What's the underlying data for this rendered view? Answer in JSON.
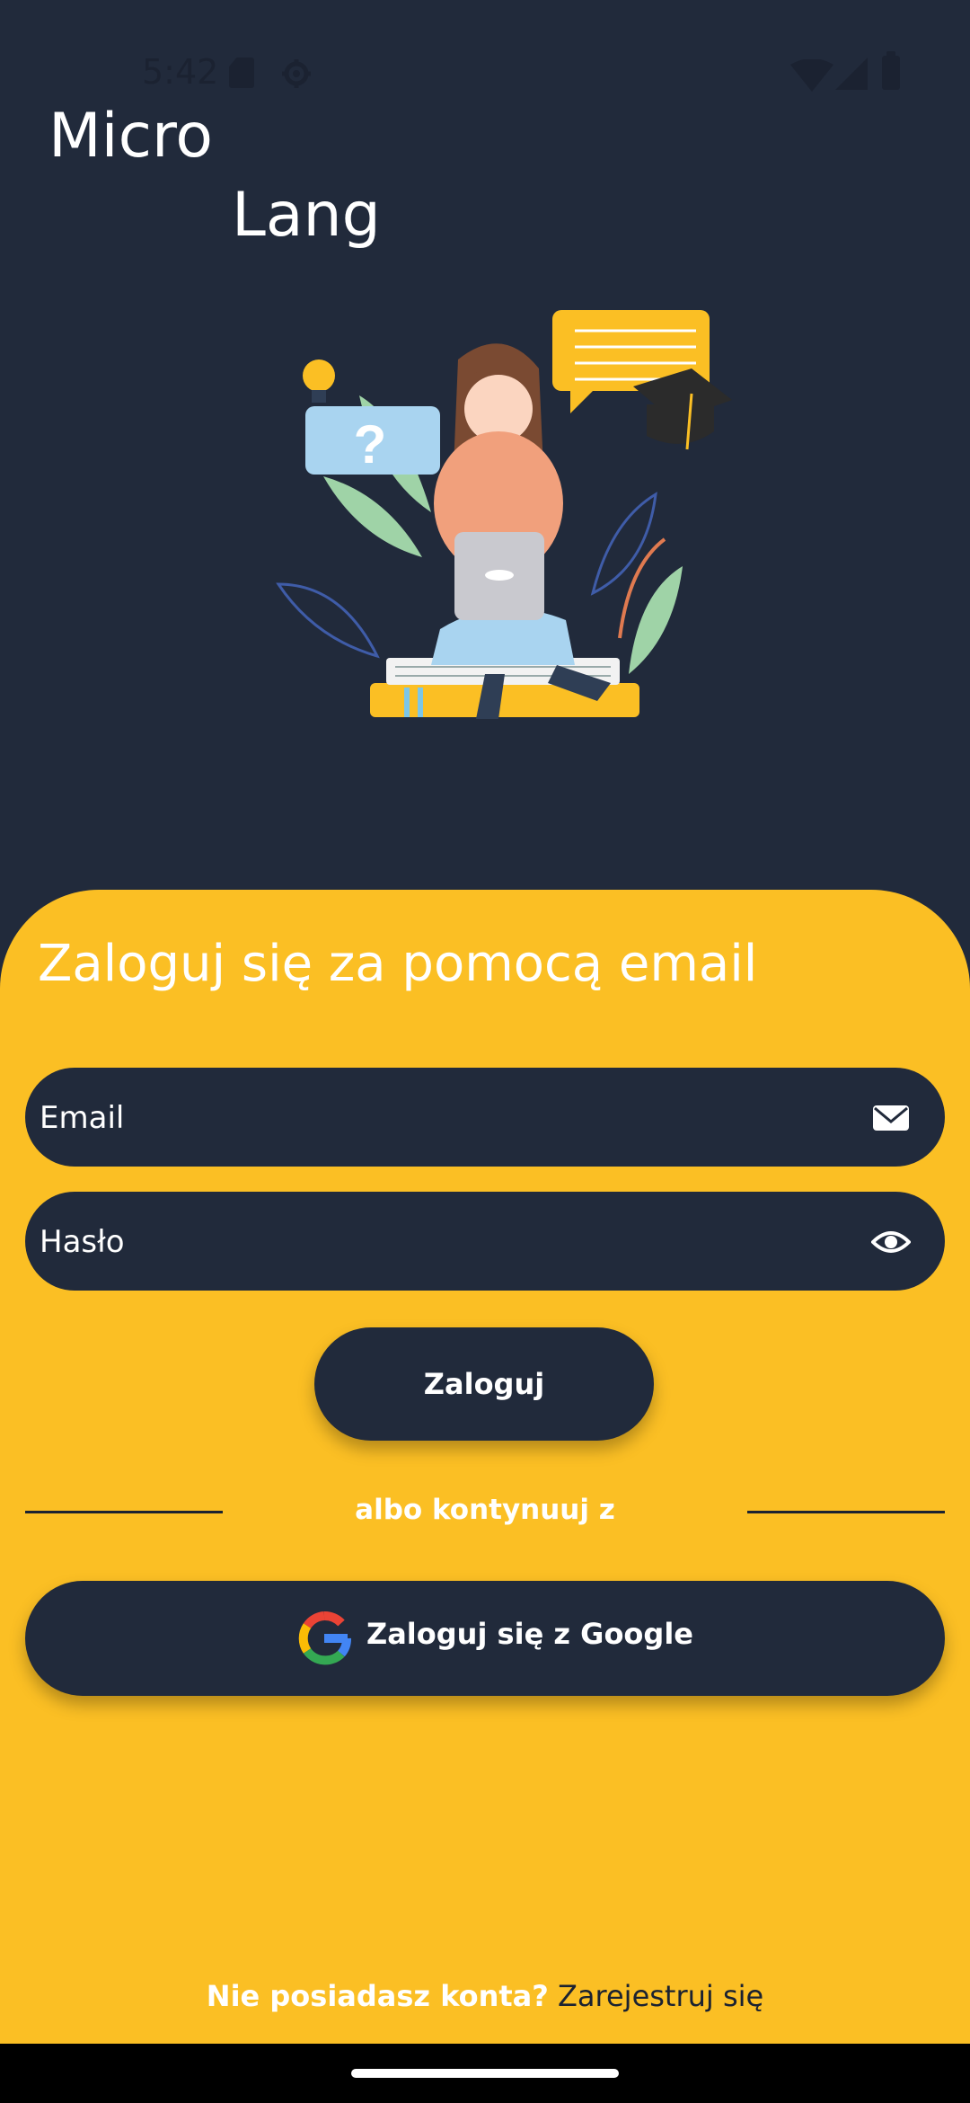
{
  "status_bar": {
    "time": "5:42"
  },
  "logo": {
    "line1": "Micro",
    "line2": "Lang"
  },
  "login": {
    "title": "Zaloguj się za pomocą email",
    "email_placeholder": "Email",
    "password_placeholder": "Hasło",
    "submit_label": "Zaloguj",
    "divider_text": "albo kontynuuj z",
    "google_label": "Zaloguj się z Google",
    "signup_question": "Nie posiadasz konta?",
    "signup_link": "Zarejestruj się"
  },
  "icons": {
    "email_field": "envelope-icon",
    "password_field": "eye-icon",
    "google": "google-icon"
  },
  "colors": {
    "background": "#212a3b",
    "card": "#fbbf24",
    "button": "#212a3b"
  }
}
